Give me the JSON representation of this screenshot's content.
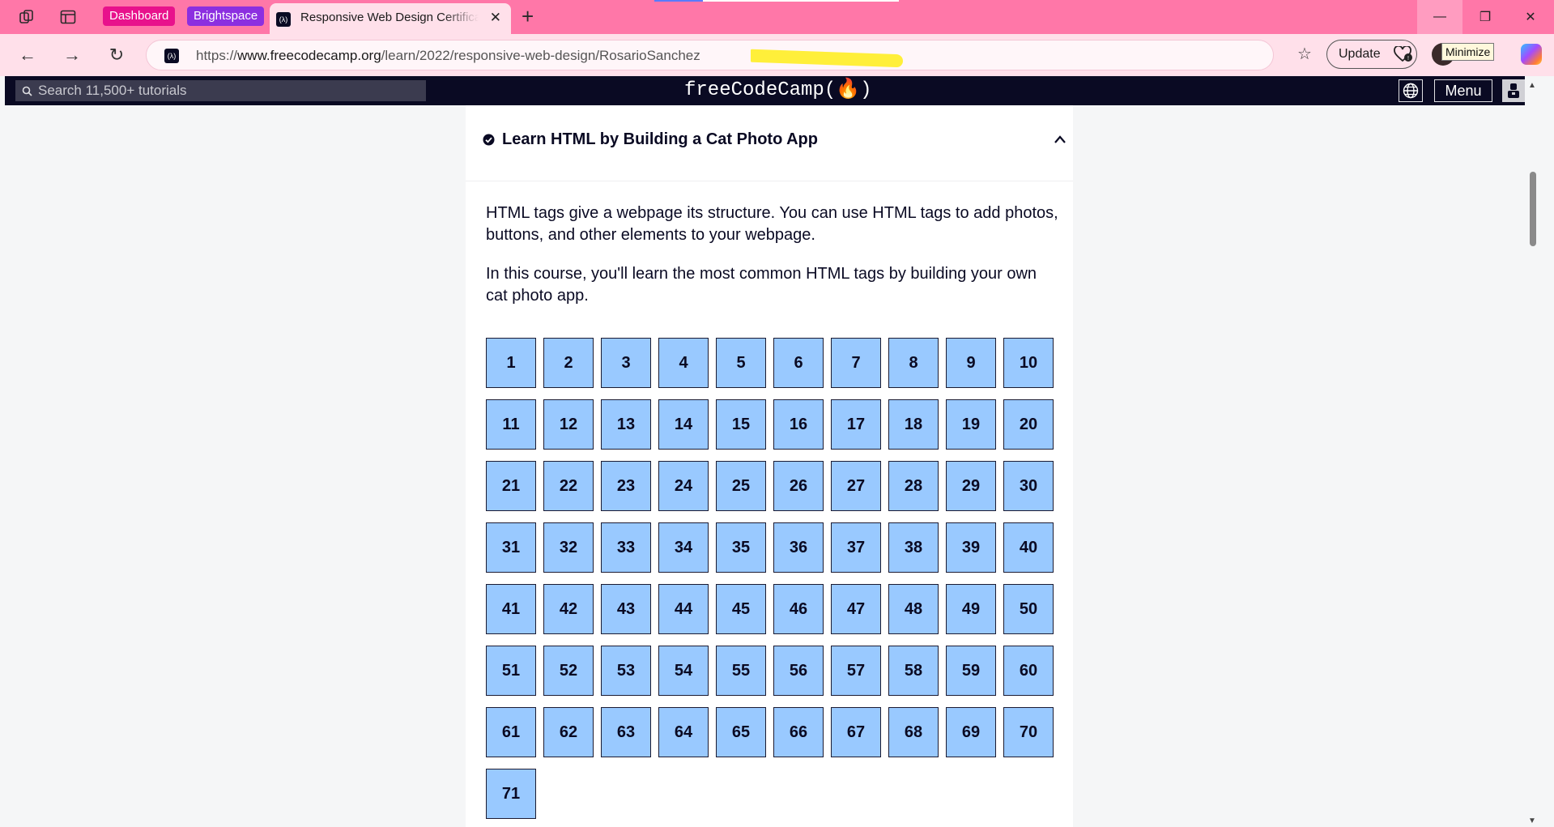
{
  "browser": {
    "tabs": {
      "pinned": [
        "Dashboard",
        "Brightspace"
      ],
      "pinned_colors": [
        "#e8128c",
        "#8c2fe0"
      ],
      "active_title": "Responsive Web Design Certification",
      "close_glyph": "✕",
      "new_tab_glyph": "+"
    },
    "window_controls": {
      "minimize": "—",
      "maximize": "❐",
      "close": "✕"
    },
    "nav": {
      "back": "←",
      "forward": "→",
      "reload": "↻"
    },
    "url": {
      "prefix": "https://",
      "domain": "www.freecodecamp.org",
      "path": "/learn/2022/responsive-web-design",
      "highlighted": "/RosarioSanchez",
      "highlight_color": "#ffef3a"
    },
    "favorites_glyph": "☆",
    "update_label": "Update",
    "tooltip": "Minimize"
  },
  "fcc_nav": {
    "search_placeholder": "Search 11,500+ tutorials",
    "brand": "freeCodeCamp(🔥)",
    "menu_label": "Menu"
  },
  "block": {
    "title": "Learn HTML by Building a Cat Photo App",
    "description": [
      "HTML tags give a webpage its structure. You can use HTML tags to add photos, buttons, and other elements to your webpage.",
      "In this course, you'll learn the most common HTML tags by building your own cat photo app."
    ],
    "step_count": 71,
    "step_color": "#99c9ff"
  },
  "colors": {
    "tab_bar": "#ff77a8",
    "address_bar": "#ffe0ea",
    "fcc_nav": "#0a0a23",
    "page_bg": "#f5f6f7",
    "accent": "#99c9ff"
  }
}
